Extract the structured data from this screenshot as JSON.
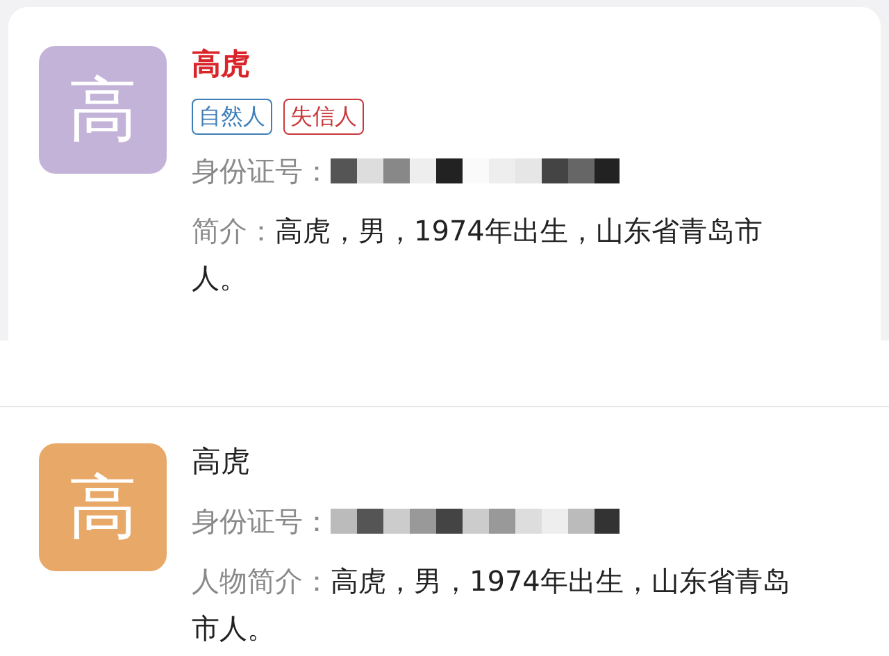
{
  "cards": [
    {
      "avatar": {
        "letter": "高",
        "color": "#c4b3d9"
      },
      "name": "高虎",
      "flagged": true,
      "tags": [
        {
          "label": "自然人",
          "color": "#3f7fb8"
        },
        {
          "label": "失信人",
          "color": "#c8383c"
        }
      ],
      "id_label": "身份证号：",
      "intro_label": "简介：",
      "intro": "高虎，男，1974年出生，山东省青岛市人。"
    },
    {
      "avatar": {
        "letter": "高",
        "color": "#e8a868"
      },
      "name": "高虎",
      "flagged": false,
      "id_label": "身份证号：",
      "intro_label": "人物简介：",
      "intro": "高虎，男，1974年出生，山东省青岛市人。"
    }
  ]
}
